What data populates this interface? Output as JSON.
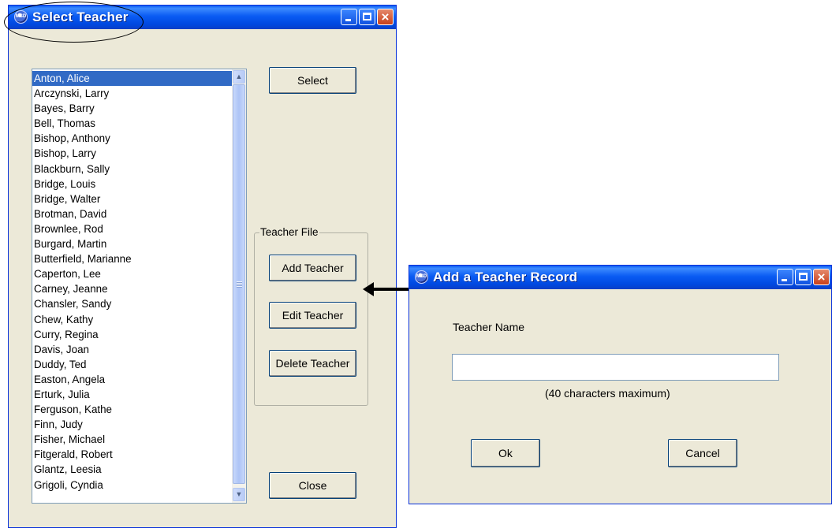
{
  "select_window": {
    "title": "Select Teacher",
    "icon": "app-logo-icon",
    "icon_text": "MSD",
    "select_button": "Select",
    "close_button": "Close",
    "group_label": "Teacher File",
    "add_button": "Add Teacher",
    "edit_button": "Edit Teacher",
    "delete_button": "Delete Teacher",
    "teachers": [
      "Anton, Alice",
      "Arczynski, Larry",
      "Bayes, Barry",
      "Bell, Thomas",
      "Bishop, Anthony",
      "Bishop, Larry",
      "Blackburn, Sally",
      "Bridge, Louis",
      "Bridge, Walter",
      "Brotman, David",
      "Brownlee, Rod",
      "Burgard, Martin",
      "Butterfield, Marianne",
      "Caperton, Lee",
      "Carney, Jeanne",
      "Chansler, Sandy",
      "Chew, Kathy",
      "Curry, Regina",
      "Davis, Joan",
      "Duddy, Ted",
      "Easton, Angela",
      "Erturk, Julia",
      "Ferguson, Kathe",
      "Finn, Judy",
      "Fisher, Michael",
      "Fitgerald, Robert",
      "Glantz, Leesia",
      "Grigoli, Cyndia"
    ],
    "selected_teacher": "Anton, Alice"
  },
  "add_window": {
    "title": "Add a Teacher Record",
    "icon_text": "MSD",
    "name_label": "Teacher Name",
    "name_value": "",
    "hint": "(40 characters maximum)",
    "ok_button": "Ok",
    "cancel_button": "Cancel"
  },
  "colors": {
    "titlebar": "#0a5bf3",
    "window_bg": "#ece9d8",
    "selection": "#316ac5",
    "close_button": "#c8401b"
  }
}
